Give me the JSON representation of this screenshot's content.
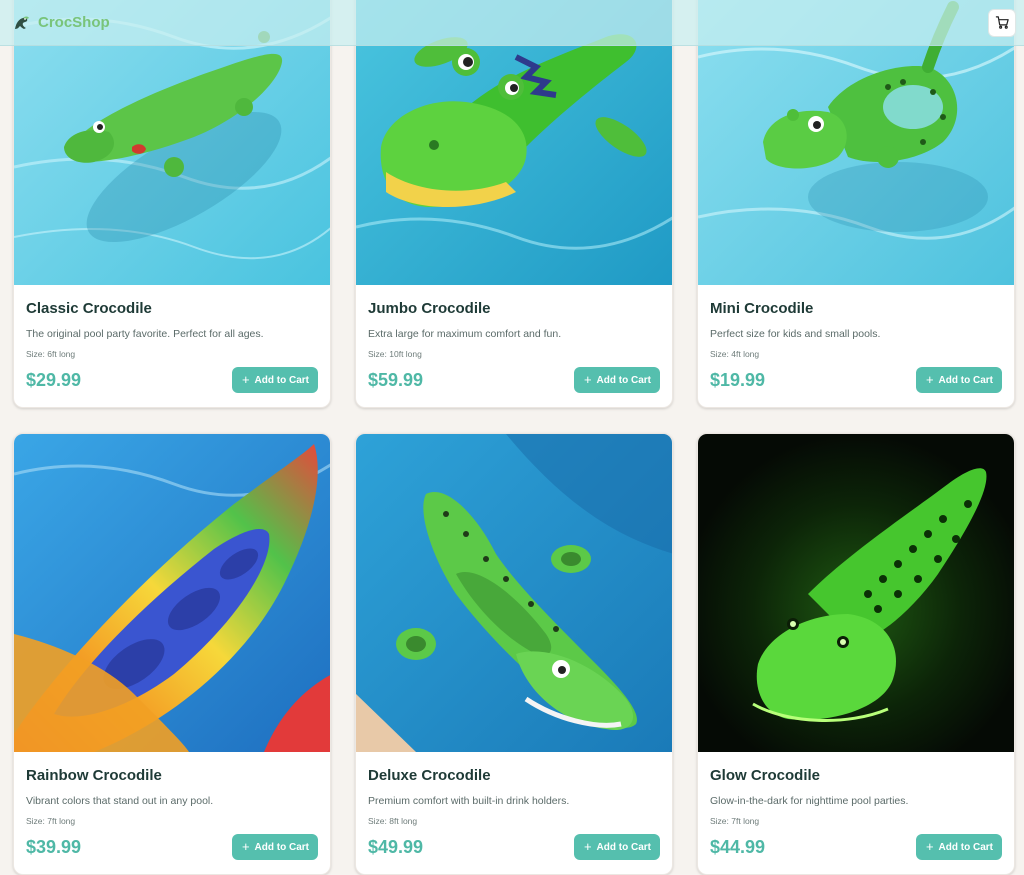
{
  "header": {
    "brand": "CrocShop",
    "logo_icon": "crocodile-logo-icon",
    "cart_icon": "cart-icon"
  },
  "products": [
    {
      "name": "Classic Crocodile",
      "description": "The original pool party favorite. Perfect for all ages.",
      "size": "Size: 6ft long",
      "price": "$29.99",
      "button": "Add to Cart",
      "button_icon": "plus-icon"
    },
    {
      "name": "Jumbo Crocodile",
      "description": "Extra large for maximum comfort and fun.",
      "size": "Size: 10ft long",
      "price": "$59.99",
      "button": "Add to Cart",
      "button_icon": "plus-icon"
    },
    {
      "name": "Mini Crocodile",
      "description": "Perfect size for kids and small pools.",
      "size": "Size: 4ft long",
      "price": "$19.99",
      "button": "Add to Cart",
      "button_icon": "plus-icon"
    },
    {
      "name": "Rainbow Crocodile",
      "description": "Vibrant colors that stand out in any pool.",
      "size": "Size: 7ft long",
      "price": "$39.99",
      "button": "Add to Cart",
      "button_icon": "plus-icon"
    },
    {
      "name": "Deluxe Crocodile",
      "description": "Premium comfort with built-in drink holders.",
      "size": "Size: 8ft long",
      "price": "$49.99",
      "button": "Add to Cart",
      "button_icon": "plus-icon"
    },
    {
      "name": "Glow Crocodile",
      "description": "Glow-in-the-dark for nighttime pool parties.",
      "size": "Size: 7ft long",
      "price": "$44.99",
      "button": "Add to Cart",
      "button_icon": "plus-icon"
    }
  ],
  "colors": {
    "brand": "#79c47a",
    "accent": "#55bfae",
    "price": "#4fb8a6",
    "background": "#f6f3ef"
  }
}
